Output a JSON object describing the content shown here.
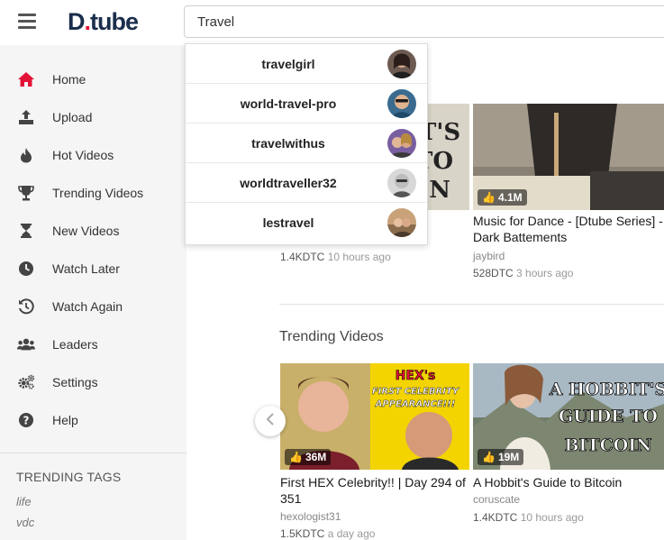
{
  "header": {
    "logo_main": "D",
    "logo_dot": ".",
    "logo_rest": "tube",
    "search_value": "Travel"
  },
  "sidebar": {
    "items": [
      {
        "label": "Home",
        "icon": "home-icon"
      },
      {
        "label": "Upload",
        "icon": "upload-icon"
      },
      {
        "label": "Hot Videos",
        "icon": "fire-icon"
      },
      {
        "label": "Trending Videos",
        "icon": "trophy-icon"
      },
      {
        "label": "New Videos",
        "icon": "hourglass-icon"
      },
      {
        "label": "Watch Later",
        "icon": "clock-icon"
      },
      {
        "label": "Watch Again",
        "icon": "history-icon"
      },
      {
        "label": "Leaders",
        "icon": "users-icon"
      },
      {
        "label": "Settings",
        "icon": "gears-icon"
      },
      {
        "label": "Help",
        "icon": "question-icon"
      }
    ],
    "tags_title": "TRENDING TAGS",
    "tags": [
      "life",
      "vdc"
    ]
  },
  "search_suggestions": [
    {
      "name": "travelgirl"
    },
    {
      "name": "world-travel-pro"
    },
    {
      "name": "travelwithus"
    },
    {
      "name": "worldtraveller32"
    },
    {
      "name": "lestravel"
    }
  ],
  "hot_videos": [
    {
      "likes": "",
      "title": "",
      "author": "",
      "dtc": "1.4KDTC",
      "ago": "10 hours ago"
    },
    {
      "likes": "4.1M",
      "title": "Music for Dance - [Dtube Series] - Dark Battements",
      "author": "jaybird",
      "dtc": "528DTC",
      "ago": "3 hours ago"
    }
  ],
  "trending": {
    "title": "Trending Videos",
    "videos": [
      {
        "likes": "36M",
        "title": "First HEX Celebrity!! | Day 294 of 351",
        "author": "hexologist31",
        "dtc": "1.5KDTC",
        "ago": "a day ago",
        "thumb_text": "HEX's FIRST CELEBRITY APPEARANCE!!!"
      },
      {
        "likes": "19M",
        "title": "A Hobbit's Guide to Bitcoin",
        "author": "coruscate",
        "dtc": "1.4KDTC",
        "ago": "10 hours ago",
        "thumb_text": "A HOBBIT'S GUIDE TO BITCOIN"
      }
    ]
  },
  "colors": {
    "brand": "#1a2e4c",
    "accent": "#e31337"
  }
}
